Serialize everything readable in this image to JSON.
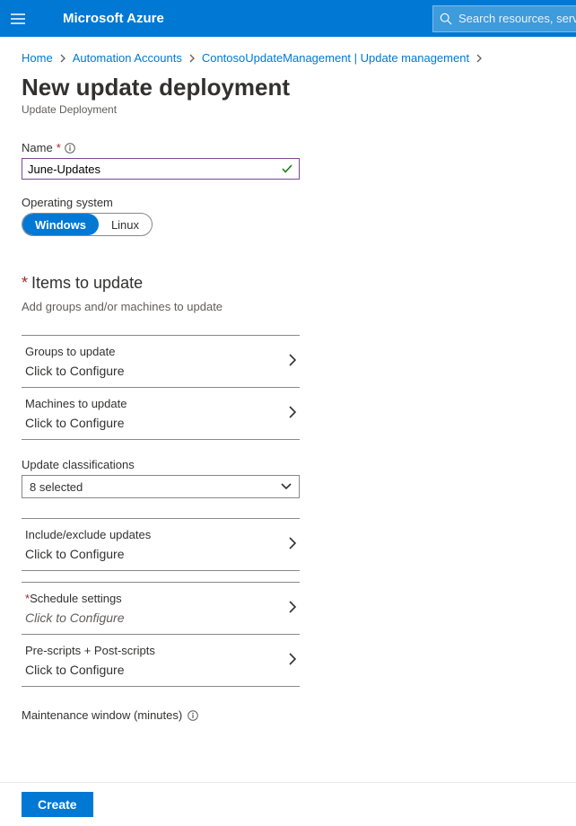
{
  "brand": "Microsoft Azure",
  "search": {
    "placeholder": "Search resources, services, and docs"
  },
  "breadcrumb": {
    "items": [
      {
        "label": "Home"
      },
      {
        "label": "Automation Accounts"
      },
      {
        "label": "ContosoUpdateManagement | Update management"
      }
    ]
  },
  "page": {
    "title": "New update deployment",
    "subtitle": "Update Deployment"
  },
  "form": {
    "name_label": "Name",
    "name_value": "June-Updates",
    "os_label": "Operating system",
    "os_options": {
      "windows": "Windows",
      "linux": "Linux"
    },
    "items_heading": "Items to update",
    "items_sub": "Add groups and/or machines to update",
    "rows": {
      "groups": {
        "title": "Groups to update",
        "sub": "Click to Configure"
      },
      "machines": {
        "title": "Machines to update",
        "sub": "Click to Configure"
      },
      "include": {
        "title": "Include/exclude updates",
        "sub": "Click to Configure"
      },
      "schedule": {
        "title": "Schedule settings",
        "sub": "Click to Configure"
      },
      "scripts": {
        "title": "Pre-scripts + Post-scripts",
        "sub": "Click to Configure"
      }
    },
    "classifications_label": "Update classifications",
    "classifications_value": "8 selected",
    "maintenance_label": "Maintenance window (minutes)",
    "create_label": "Create"
  }
}
